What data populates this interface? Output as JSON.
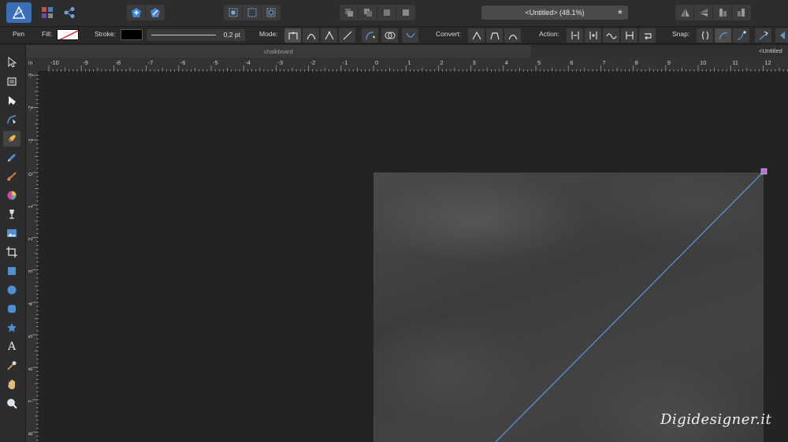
{
  "document": {
    "title": "<Untitled> (48.1%)",
    "tab_label": "chalkboard",
    "tab_right_label": "<Untitled"
  },
  "context_toolbar": {
    "tool_name": "Pen",
    "fill_label": "Fill:",
    "stroke_label": "Stroke:",
    "stroke_width": "0,2 pt",
    "mode_label": "Mode:",
    "convert_label": "Convert:",
    "action_label": "Action:",
    "snap_label": "Snap:",
    "stroke_color": "#000000",
    "fill_color": "none"
  },
  "rulers": {
    "unit": "in",
    "h_ticks": [
      "-10",
      "-9",
      "-8",
      "-7",
      "-6",
      "-5",
      "-4",
      "-3",
      "-2",
      "-1",
      "0",
      "1",
      "2",
      "3",
      "4",
      "5",
      "6",
      "7",
      "8",
      "9",
      "10",
      "11",
      "12"
    ],
    "v_ticks": [
      "-3",
      "-2",
      "-1",
      "0",
      "1",
      "2",
      "3",
      "4",
      "5",
      "6",
      "7",
      "8"
    ]
  },
  "watermark": "Digidesigner.it",
  "colors": {
    "accent": "#4a90e2",
    "path_line": "#5b8ed6",
    "node": "#b46ad8"
  },
  "icons": {
    "tools": [
      "move-icon",
      "artboard-icon",
      "node-icon",
      "corner-icon",
      "pen-icon",
      "pencil-icon",
      "paint-brush-icon",
      "fill-icon",
      "transparency-icon",
      "place-image-icon",
      "crop-icon",
      "rectangle-icon",
      "ellipse-icon",
      "rounded-rectangle-icon",
      "star-icon",
      "text-icon",
      "color-picker-icon",
      "hand-icon",
      "zoom-icon"
    ]
  }
}
